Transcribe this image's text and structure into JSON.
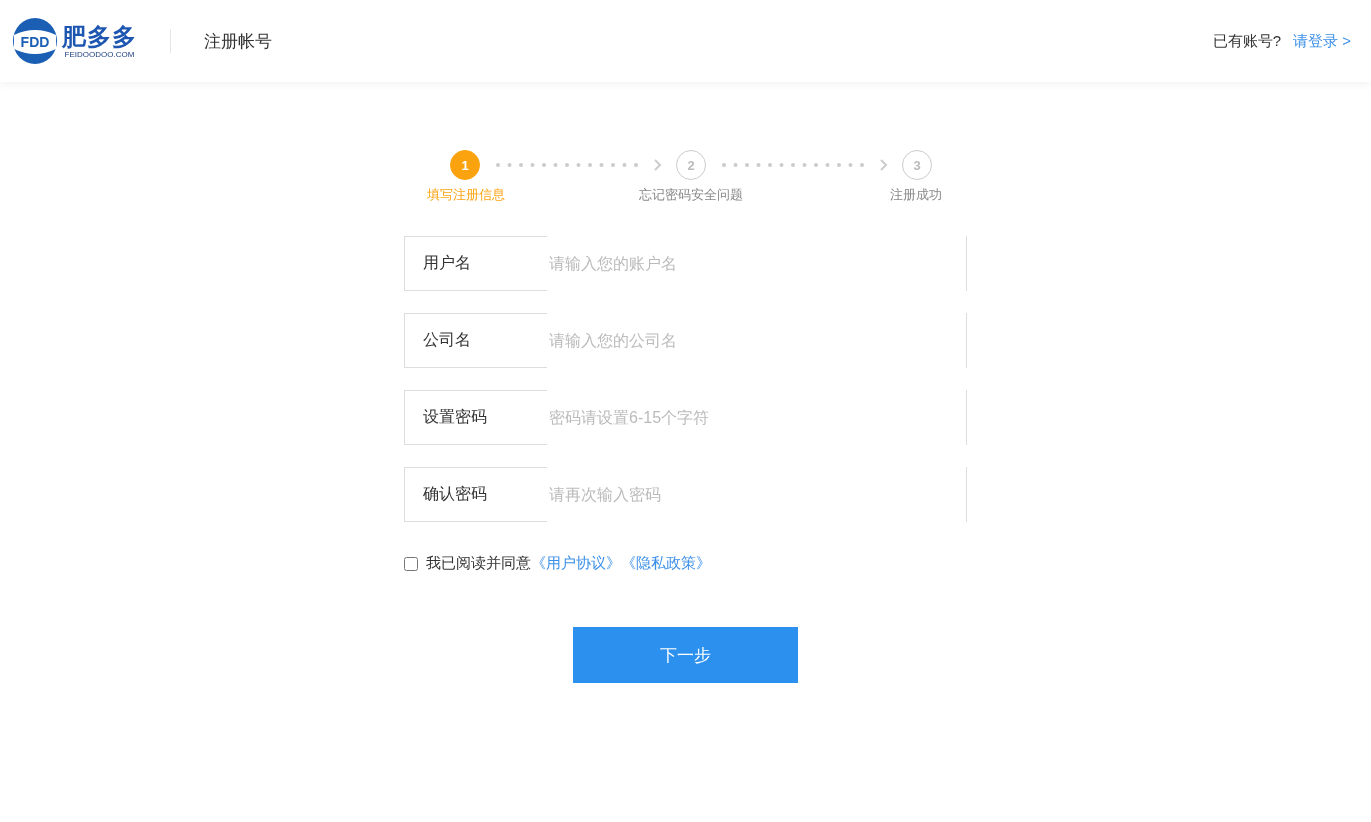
{
  "header": {
    "logo": {
      "mark": "FDD",
      "name": "肥多多",
      "domain": "FEIDOODOO.COM"
    },
    "title": "注册帐号",
    "login_prompt": "已有账号?",
    "login_link": "请登录 >"
  },
  "steps": [
    {
      "number": "1",
      "label": "填写注册信息",
      "active": true
    },
    {
      "number": "2",
      "label": "忘记密码安全问题",
      "active": false
    },
    {
      "number": "3",
      "label": "注册成功",
      "active": false
    }
  ],
  "fields": [
    {
      "label": "用户名",
      "placeholder": "请输入您的账户名"
    },
    {
      "label": "公司名",
      "placeholder": "请输入您的公司名"
    },
    {
      "label": "设置密码",
      "placeholder": "密码请设置6-15个字符"
    },
    {
      "label": "确认密码",
      "placeholder": "请再次输入密码"
    }
  ],
  "agreement": {
    "checked": false,
    "text": "我已阅读并同意",
    "links": [
      "《用户协议》",
      "《隐私政策》"
    ]
  },
  "submit": "下一步"
}
